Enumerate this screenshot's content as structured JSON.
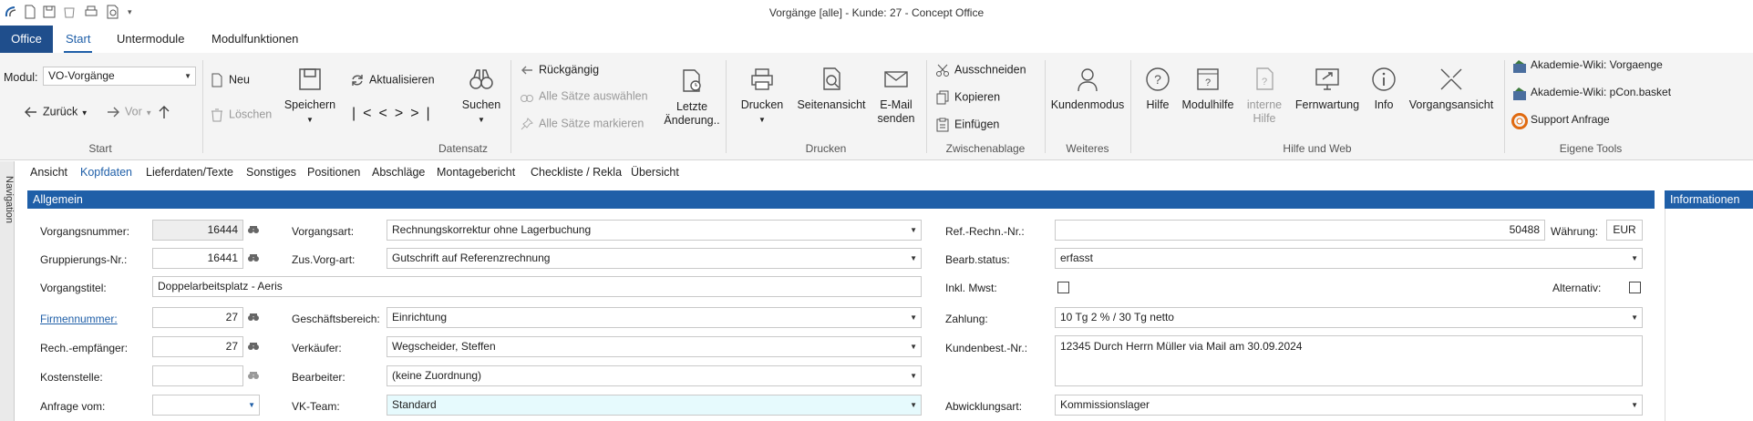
{
  "window": {
    "title": "Vorgänge [alle] - Kunde: 27 - Concept Office"
  },
  "ribbon_tabs": [
    {
      "label": "Office"
    },
    {
      "label": "Start"
    },
    {
      "label": "Untermodule"
    },
    {
      "label": "Modulfunktionen"
    }
  ],
  "ribbon": {
    "start": {
      "modul_label": "Modul:",
      "modul_value": "VO-Vorgänge",
      "back_label": "Zurück",
      "forward_label": "Vor",
      "group_label": "Start"
    },
    "datensatz": {
      "neu": "Neu",
      "loeschen": "Löschen",
      "speichern": "Speichern",
      "aktualisieren": "Aktualisieren",
      "suchen": "Suchen",
      "rueckgaengig": "Rückgängig",
      "alle_auswaehlen": "Alle Sätze auswählen",
      "alle_markieren": "Alle Sätze markieren",
      "letzte_aenderung_1": "Letzte",
      "letzte_aenderung_2": "Änderung..",
      "group_label": "Datensatz"
    },
    "drucken": {
      "drucken": "Drucken",
      "seitenansicht": "Seitenansicht",
      "email_1": "E-Mail",
      "email_2": "senden",
      "group_label": "Drucken"
    },
    "zwischenablage": {
      "ausschneiden": "Ausschneiden",
      "kopieren": "Kopieren",
      "einfuegen": "Einfügen",
      "group_label": "Zwischenablage"
    },
    "weiteres": {
      "kundenmodus": "Kundenmodus",
      "group_label": "Weiteres"
    },
    "hilfe": {
      "hilfe": "Hilfe",
      "modulhilfe": "Modulhilfe",
      "interne_1": "interne",
      "interne_2": "Hilfe",
      "fernwartung": "Fernwartung",
      "info": "Info",
      "vorgangsansicht": "Vorgangsansicht",
      "group_label": "Hilfe und Web"
    },
    "eigene_tools": {
      "wiki1": "Akademie-Wiki: Vorgaenge",
      "wiki2": "Akademie-Wiki: pCon.basket",
      "support": "Support Anfrage",
      "group_label": "Eigene Tools"
    }
  },
  "navigation": {
    "label": "Navigation"
  },
  "sub_tabs": [
    {
      "label": "Ansicht"
    },
    {
      "label": "Kopfdaten"
    },
    {
      "label": "Lieferdaten/Texte"
    },
    {
      "label": "Sonstiges"
    },
    {
      "label": "Positionen"
    },
    {
      "label": "Abschläge"
    },
    {
      "label": "Montagebericht"
    },
    {
      "label": "Checkliste / Rekla"
    },
    {
      "label": "Übersicht"
    }
  ],
  "sections": {
    "allgemein": "Allgemein",
    "informationen": "Informationen"
  },
  "form": {
    "vorgangsnummer": {
      "label": "Vorgangsnummer:",
      "value": "16444"
    },
    "gruppierungs_nr": {
      "label": "Gruppierungs-Nr.:",
      "value": "16441"
    },
    "vorgangstitel": {
      "label": "Vorgangstitel:",
      "value": "Doppelarbeitsplatz - Aeris"
    },
    "firmennummer": {
      "label": "Firmennummer:",
      "value": "27"
    },
    "rech_empfaenger": {
      "label": "Rech.-empfänger:",
      "value": "27"
    },
    "kostenstelle": {
      "label": "Kostenstelle:",
      "value": ""
    },
    "anfrage_vom": {
      "label": "Anfrage vom:",
      "value": ""
    },
    "vorgangsart": {
      "label": "Vorgangsart:",
      "value": "Rechnungskorrektur ohne Lagerbuchung"
    },
    "zus_vorg_art": {
      "label": "Zus.Vorg-art:",
      "value": "Gutschrift auf Referenzrechnung"
    },
    "geschaeftsbereich": {
      "label": "Geschäftsbereich:",
      "value": "Einrichtung"
    },
    "verkaeufer": {
      "label": "Verkäufer:",
      "value": "Wegscheider, Steffen"
    },
    "bearbeiter": {
      "label": "Bearbeiter:",
      "value": "(keine Zuordnung)"
    },
    "vk_team": {
      "label": "VK-Team:",
      "value": "Standard"
    },
    "ref_rechn_nr": {
      "label": "Ref.-Rechn.-Nr.:",
      "value": "50488"
    },
    "waehrung": {
      "label": "Währung:",
      "value": "EUR"
    },
    "bearb_status": {
      "label": "Bearb.status:",
      "value": "erfasst"
    },
    "inkl_mwst": {
      "label": "Inkl. Mwst:",
      "checked": false
    },
    "alternativ": {
      "label": "Alternativ:",
      "checked": false
    },
    "zahlung": {
      "label": "Zahlung:",
      "value": "10 Tg 2 % / 30 Tg netto"
    },
    "kundenbest_nr": {
      "label": "Kundenbest.-Nr.:",
      "value": "12345 Durch Herrn Müller via Mail am  30.09.2024"
    },
    "abwicklungsart": {
      "label": "Abwicklungsart:",
      "value": "Kommissionslager"
    }
  },
  "colors": {
    "accent": "#1f5fa8",
    "office_tab": "#1f4e8c",
    "ribbon_bg": "#f4f4f4",
    "vk_team_bg": "#e6fafd"
  }
}
